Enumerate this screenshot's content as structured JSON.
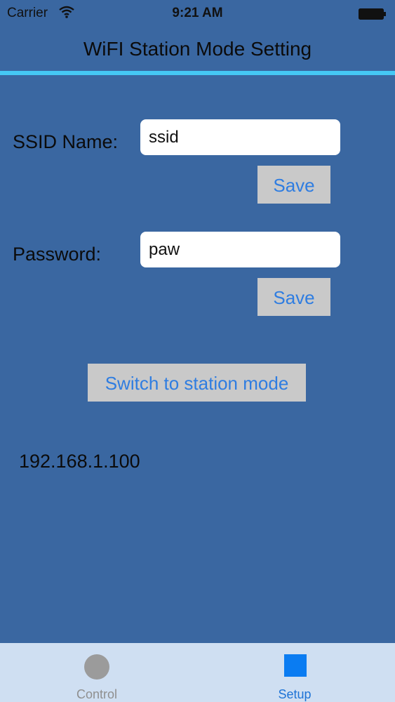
{
  "status_bar": {
    "carrier": "Carrier",
    "time": "9:21 AM",
    "icons": [
      "wifi-icon",
      "battery-icon"
    ]
  },
  "nav": {
    "title": "WiFI Station Mode Setting"
  },
  "form": {
    "ssid_label": "SSID Name:",
    "ssid_value": "ssid",
    "ssid_save": "Save",
    "password_label": "Password:",
    "password_value": "paw",
    "password_save": "Save",
    "switch_button": "Switch to station mode"
  },
  "ip_address": "192.168.1.100",
  "tab_bar": {
    "tabs": [
      {
        "label": "Control",
        "icon": "circle-icon",
        "selected": false
      },
      {
        "label": "Setup",
        "icon": "square-icon",
        "selected": true
      }
    ]
  },
  "colors": {
    "background": "#3a67a1",
    "accent_line": "#45c8f4",
    "button_text": "#2f7de1",
    "tab_bar": "#cfdff2",
    "selected_tab": "#0a7cf2"
  }
}
